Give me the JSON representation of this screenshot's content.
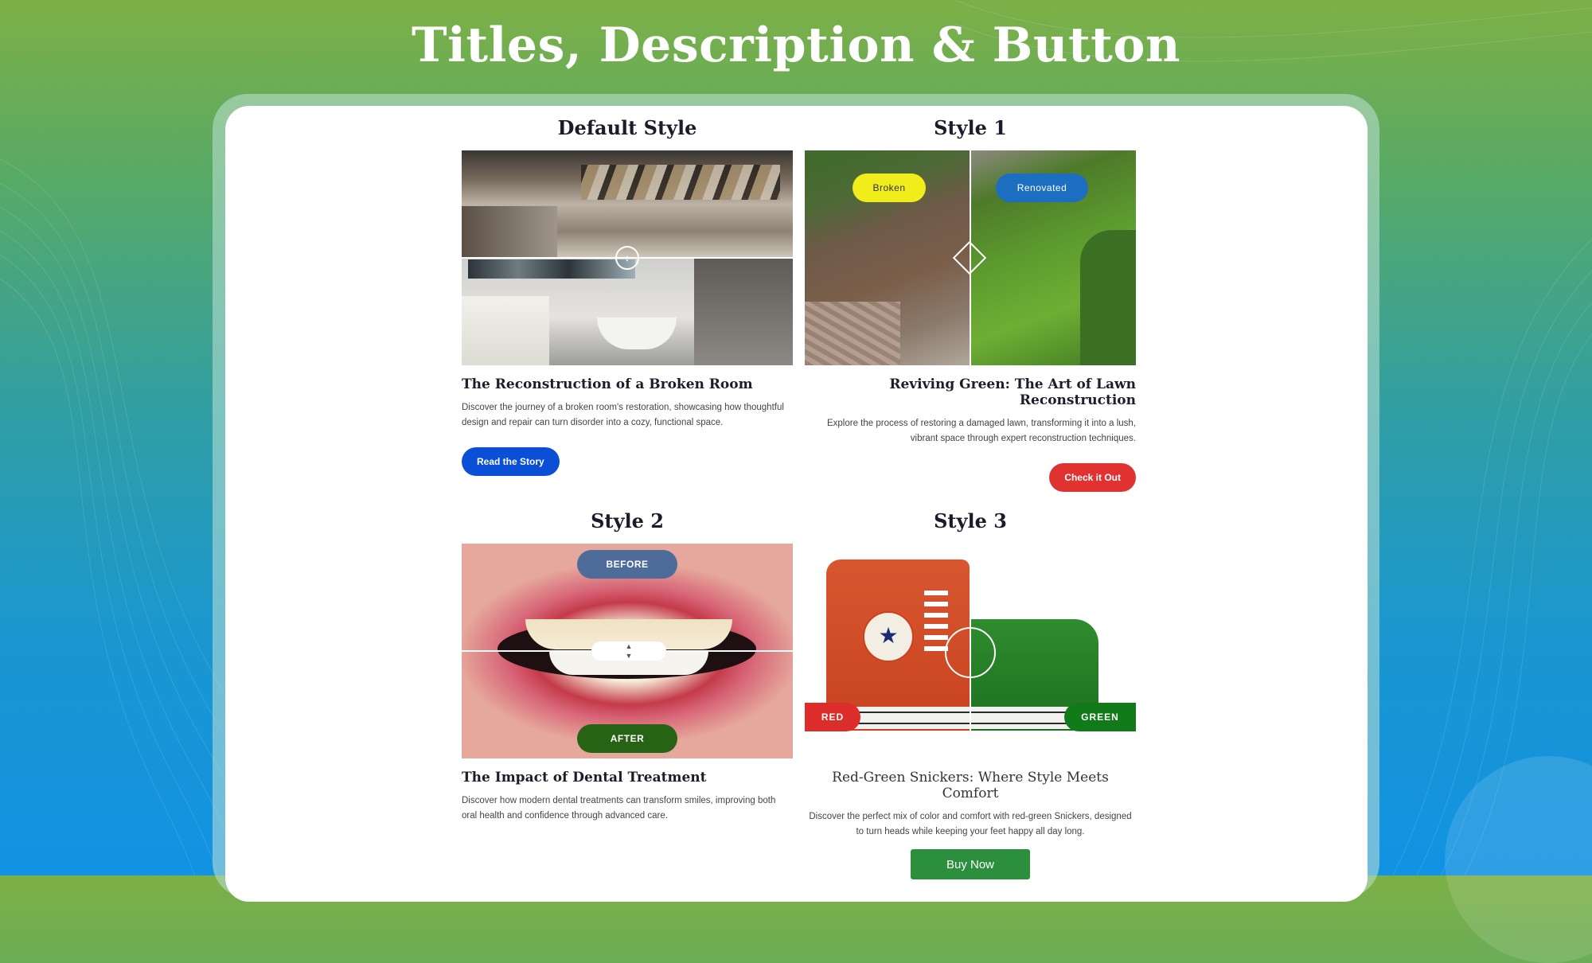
{
  "page": {
    "title": "Titles, Description & Button"
  },
  "cards": [
    {
      "style_name": "Default Style",
      "title": "The Reconstruction of a Broken Room",
      "description": "Discover the journey of a broken room's restoration, showcasing how thoughtful design and repair can turn disorder into a cozy, functional space.",
      "button": "Read the Story",
      "button_color": "#0a4fd6"
    },
    {
      "style_name": "Style 1",
      "title": "Reviving Green: The Art of Lawn Reconstruction",
      "description": "Explore the process of restoring a damaged lawn, transforming it into a lush, vibrant space through expert reconstruction techniques.",
      "button": "Check it Out",
      "button_color": "#e03331",
      "before_label": "Broken",
      "after_label": "Renovated"
    },
    {
      "style_name": "Style 2",
      "title": "The Impact of Dental Treatment",
      "description": "Discover how modern dental treatments can transform smiles, improving both oral health and confidence through advanced care.",
      "before_label": "BEFORE",
      "after_label": "AFTER"
    },
    {
      "style_name": "Style 3",
      "title": "Red-Green Snickers: Where Style Meets Comfort",
      "description": "Discover the perfect mix of color and comfort with red-green Snickers, designed to turn heads while keeping your feet happy all day long.",
      "button": "Buy Now",
      "button_color": "#2c8f3e",
      "before_label": "RED",
      "after_label": "GREEN"
    }
  ],
  "colors": {
    "broken_tag": "#f1ec1b",
    "renovated_tag": "#1c6fc0",
    "before_tag": "#4d6c9a",
    "after_tag": "#276315",
    "red_tag": "#dc2d2b",
    "green_tag": "#117a19"
  }
}
